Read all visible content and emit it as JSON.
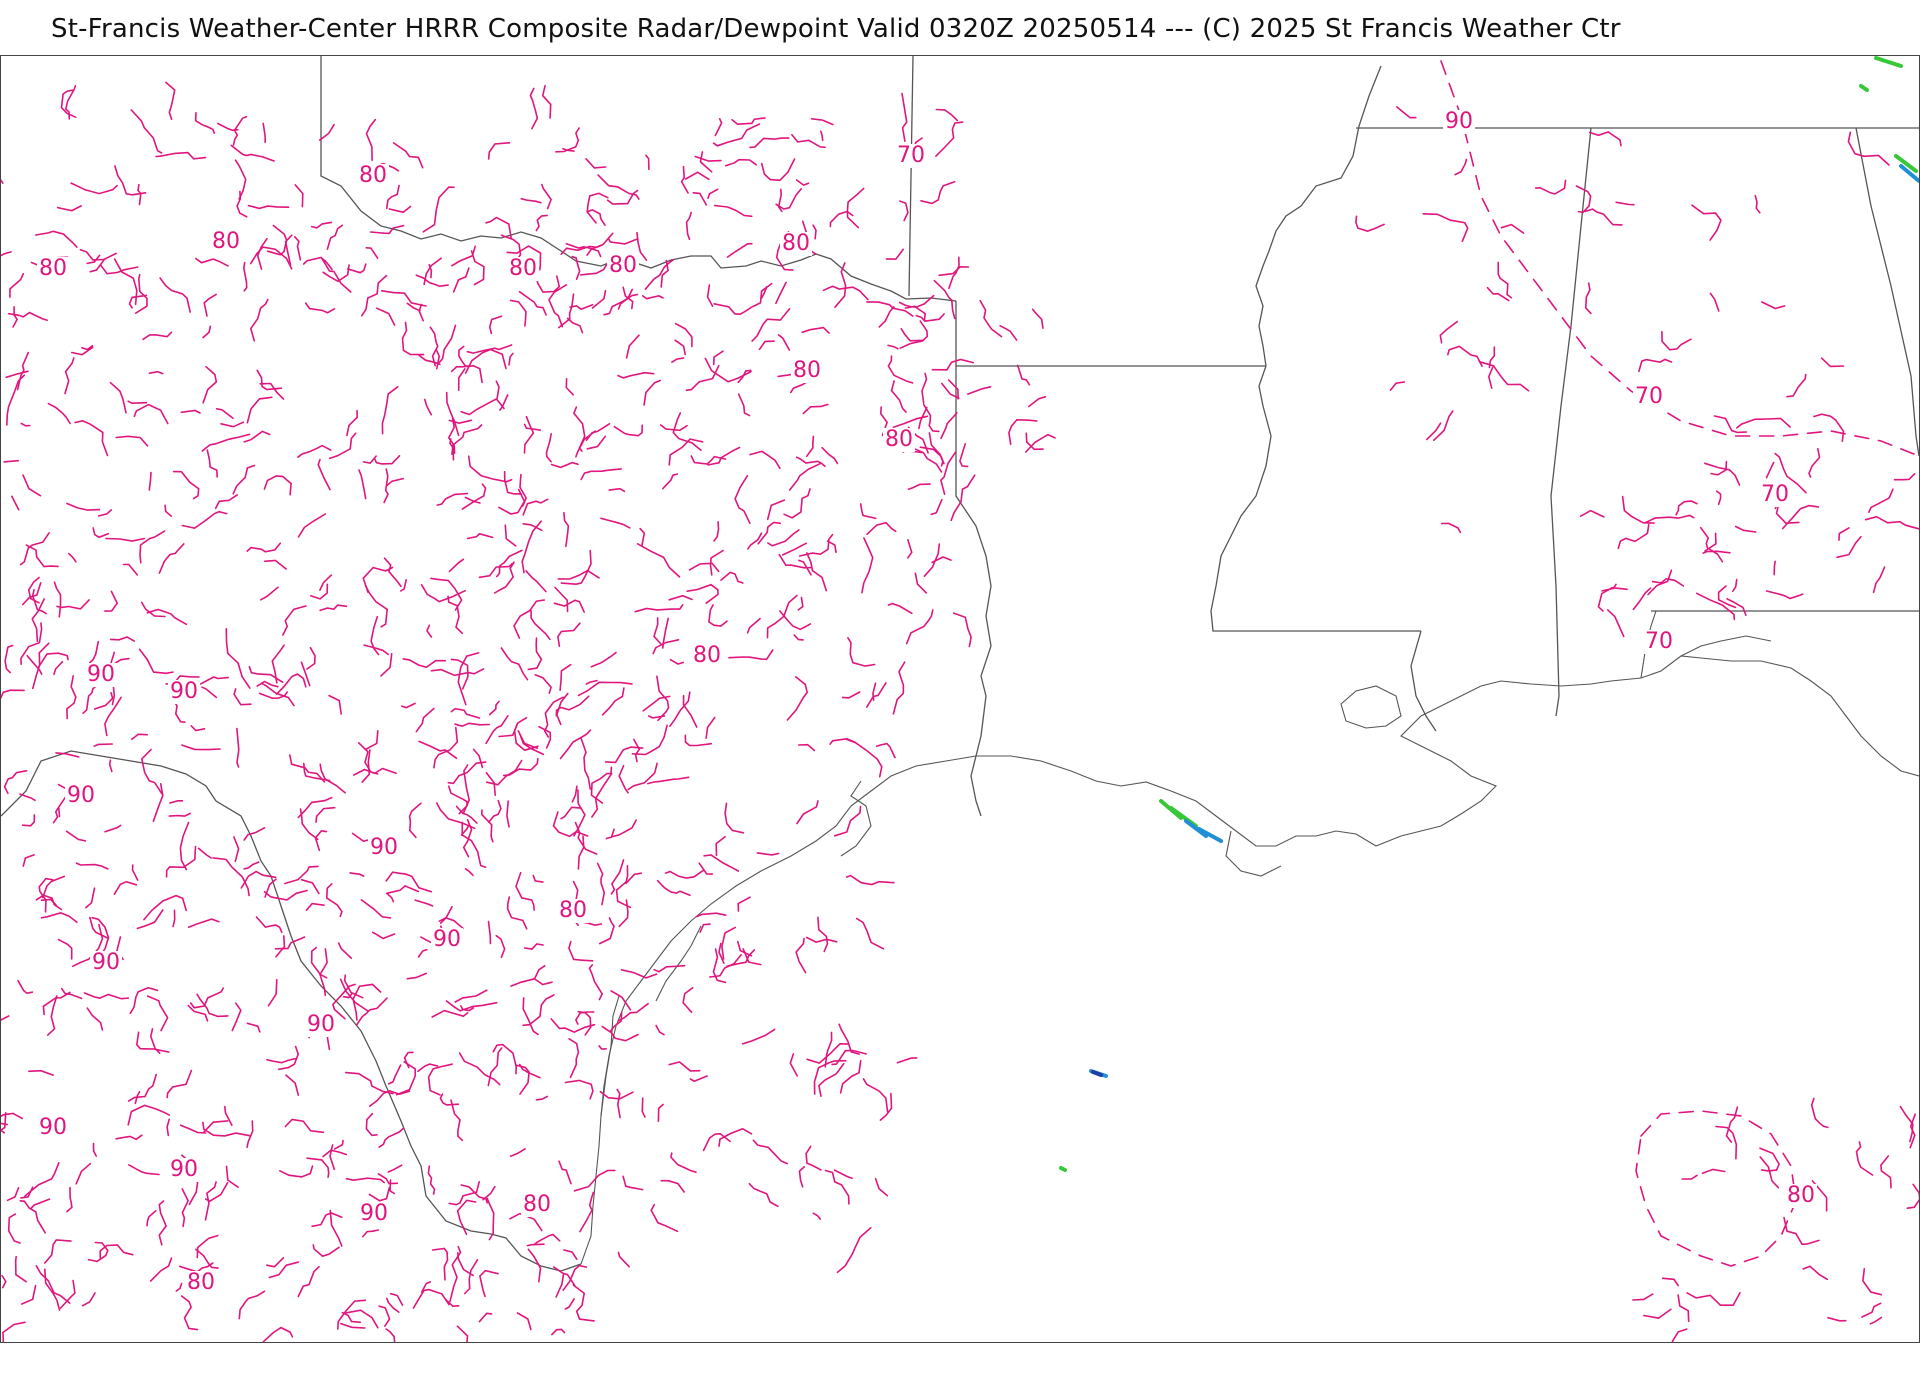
{
  "header": {
    "title": "St-Francis Weather-Center HRRR Composite Radar/Dewpoint  Valid  0320Z 20250514  --- (C) 2025 St Francis Weather Ctr"
  },
  "map": {
    "product": "HRRR Composite Radar/Dewpoint",
    "colors": {
      "dewpoint_contour": "#e0157e",
      "state_border": "#555555",
      "coastline": "#555555",
      "radar_light": "#37c837",
      "radar_medium": "#1f8fd6",
      "radar_heavy": "#1e3fa8"
    },
    "dewpoint_labels": [
      "80",
      "80",
      "80",
      "80",
      "80",
      "80",
      "80",
      "80",
      "80",
      "80",
      "80",
      "80",
      "80",
      "90",
      "90",
      "90",
      "90",
      "90",
      "90",
      "90",
      "90",
      "90",
      "90",
      "90",
      "70",
      "70",
      "70",
      "70"
    ]
  }
}
